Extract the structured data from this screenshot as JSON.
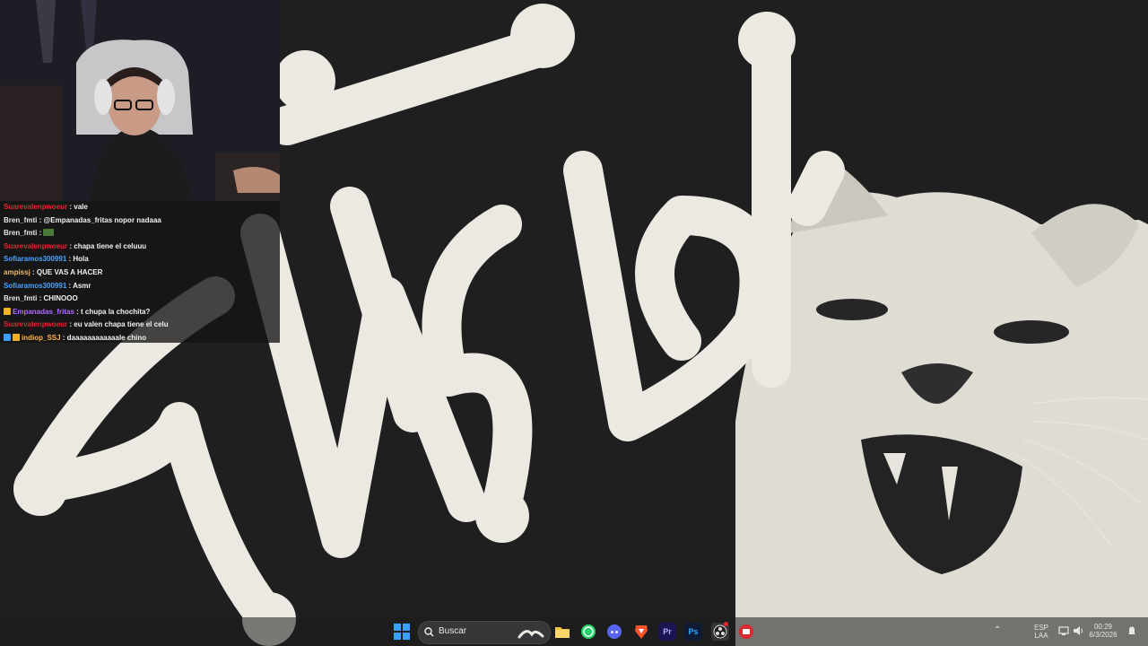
{
  "chat": {
    "messages": [
      {
        "user": "Suarevalenpwoeur",
        "color": "#e0282f",
        "badge": "",
        "text": "vale"
      },
      {
        "user": "Bren_fmti",
        "color": "#e6e6e6",
        "badge": "",
        "text": "@Empanadas_fritas nopor nadaaa"
      },
      {
        "user": "Bren_fmti",
        "color": "#e6e6e6",
        "badge": "",
        "text": ""
      },
      {
        "user": "Suarevalenpwoeur",
        "color": "#e0282f",
        "badge": "",
        "text": "chapa tiene el celuuu"
      },
      {
        "user": "Sofiaramos300991",
        "color": "#4aa3ff",
        "badge": "",
        "text": "Hola"
      },
      {
        "user": "ampissj",
        "color": "#e8b86a",
        "badge": "",
        "text": "QUE VAS A HACER"
      },
      {
        "user": "Sofiaramos300991",
        "color": "#4aa3ff",
        "badge": "",
        "text": "Asmr"
      },
      {
        "user": "Bren_fmti",
        "color": "#e6e6e6",
        "badge": "",
        "text": "CHINOOO"
      },
      {
        "user": "Empanadas_fritas",
        "color": "#b36bff",
        "badge": "gold",
        "text": "t chupa la chochita?"
      },
      {
        "user": "Suarevalenpwoeur",
        "color": "#e0282f",
        "badge": "",
        "text": "eu valen chapa tiene el celu"
      },
      {
        "user": "indiop_SSJ",
        "color": "#ffb44a",
        "badge": "multi",
        "text": "daaaaaaaaaaaale chino"
      }
    ]
  },
  "wallpaper": {
    "graffiti_text": "Stussy",
    "accent": "#ebe9e1",
    "background": "#1f1f1f"
  },
  "taskbar": {
    "search_placeholder": "Buscar",
    "apps": [
      {
        "name": "windows-start",
        "color": "#2f8ff5"
      },
      {
        "name": "file-explorer",
        "color": "#f5c443"
      },
      {
        "name": "whatsapp",
        "color": "#25d366"
      },
      {
        "name": "discord",
        "color": "#5865f2"
      },
      {
        "name": "brave",
        "color": "#fb542b"
      },
      {
        "name": "premiere-pro",
        "label": "Pr",
        "color": "#1a1450"
      },
      {
        "name": "photoshop",
        "label": "Ps",
        "color": "#0f1a33"
      },
      {
        "name": "obs",
        "color": "#3a3a3a"
      },
      {
        "name": "red-app",
        "color": "#e0282f"
      }
    ],
    "tray": {
      "language_top": "ESP",
      "language_bottom": "LAA",
      "time": "00:29",
      "date": "6/3/2026"
    }
  }
}
